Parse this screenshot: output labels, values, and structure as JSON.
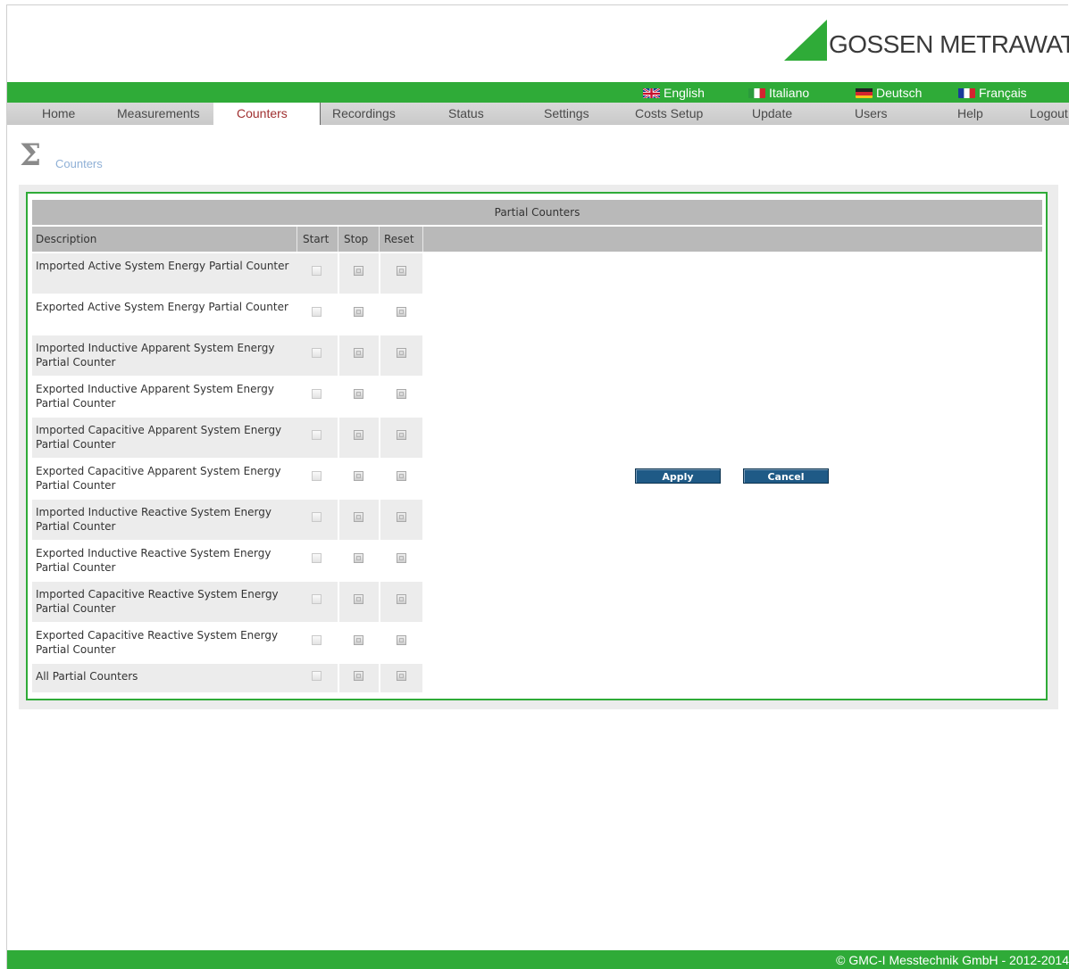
{
  "brand": {
    "logo_text": "GOSSEN METRAWATT",
    "accent_color": "#2fab38"
  },
  "languages": [
    {
      "label": "English",
      "flag": "uk-flag"
    },
    {
      "label": "Italiano",
      "flag": "italy-flag"
    },
    {
      "label": "Deutsch",
      "flag": "germany-flag"
    },
    {
      "label": "Français",
      "flag": "france-flag"
    }
  ],
  "nav": {
    "items": [
      "Home",
      "Measurements",
      "Counters",
      "Recordings",
      "Status",
      "Settings",
      "Costs Setup",
      "Update",
      "Users",
      "Help",
      "Logout"
    ],
    "active": "Counters"
  },
  "page": {
    "title": "Counters",
    "icon": "sigma-icon"
  },
  "table": {
    "title": "Partial Counters",
    "columns": {
      "description": "Description",
      "start": "Start",
      "stop": "Stop",
      "reset": "Reset"
    },
    "rows": [
      "Imported Active System Energy Partial Counter",
      "Exported Active System Energy Partial Counter",
      "Imported Inductive Apparent System Energy Partial Counter",
      "Exported Inductive Apparent System Energy Partial Counter",
      "Imported Capacitive Apparent System Energy Partial Counter",
      "Exported Capacitive Apparent System Energy Partial Counter",
      "Imported Inductive Reactive System Energy Partial Counter",
      "Exported Inductive Reactive System Energy Partial Counter",
      "Imported Capacitive Reactive System Energy Partial Counter",
      "Exported Capacitive Reactive System Energy Partial Counter",
      "All Partial Counters"
    ]
  },
  "buttons": {
    "apply": "Apply",
    "cancel": "Cancel"
  },
  "footer": {
    "copyright": "© GMC-I Messtechnik GmbH - 2012-2014"
  }
}
